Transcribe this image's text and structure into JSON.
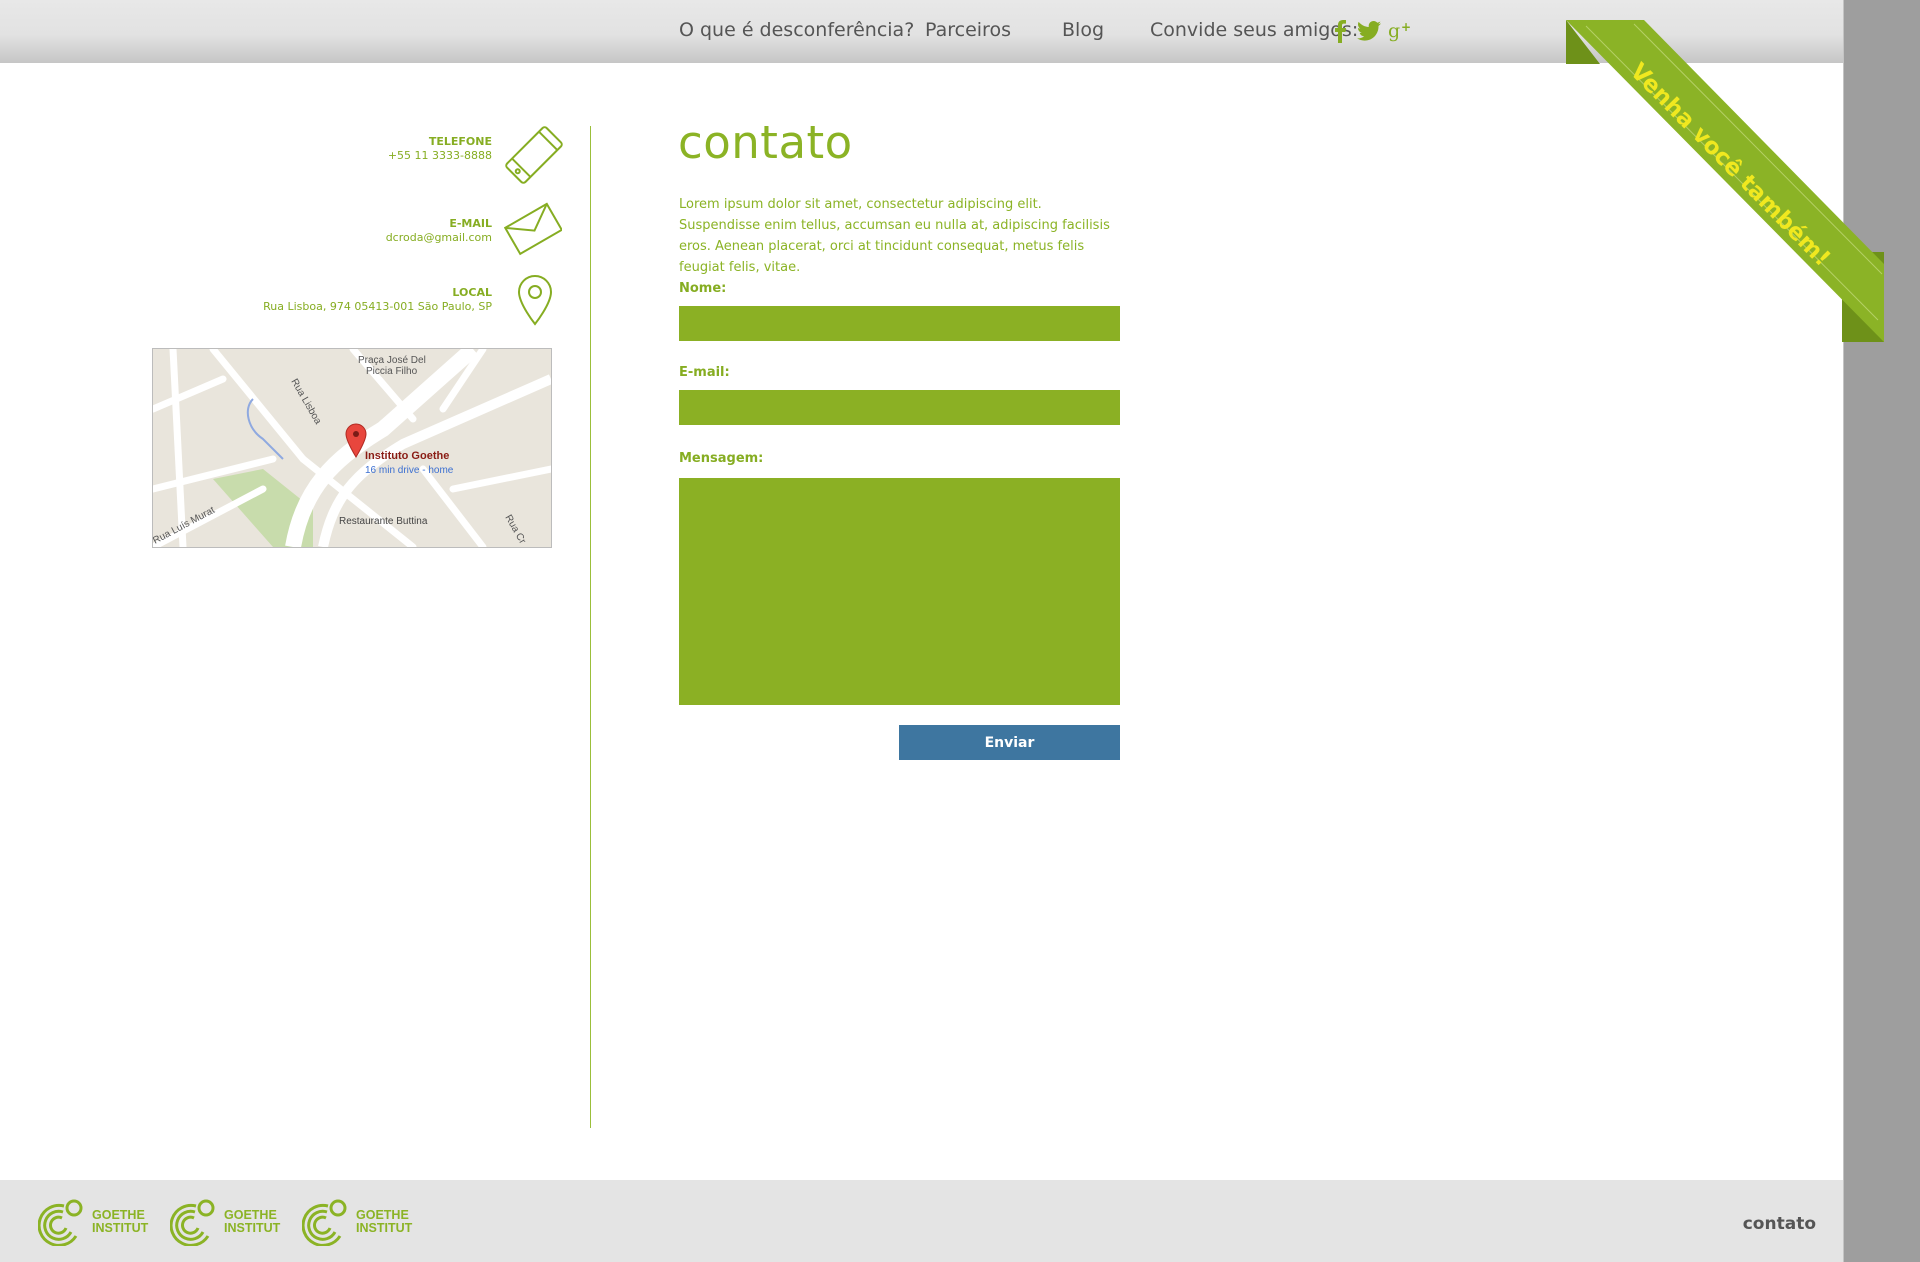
{
  "nav": {
    "items": [
      "O que é desconferência?",
      "Parceiros",
      "Blog"
    ],
    "invite_label": "Convide seus amigos:",
    "social": [
      {
        "name": "facebook-icon",
        "glyph": "f"
      },
      {
        "name": "twitter-icon",
        "glyph": "twitter"
      },
      {
        "name": "google-plus-icon",
        "glyph": "g+"
      }
    ]
  },
  "ribbon": {
    "text": "Venha você também!"
  },
  "contact_info": {
    "phone": {
      "label": "TELEFONE",
      "value": "+55 11 3333-8888"
    },
    "email": {
      "label": "E-MAIL",
      "value": "dcroda@gmail.com"
    },
    "location": {
      "label": "LOCAL",
      "value": "Rua Lisboa, 974 05413-001 São Paulo, SP"
    }
  },
  "map": {
    "place_name": "Instituto Goethe",
    "directions": "16 min drive - home",
    "street_labels": [
      "Rua Lisboa",
      "Praça José Del",
      "Piccia Filho",
      "Rua Luís Murat",
      "Restaurante Buttina",
      "Rua Cr"
    ]
  },
  "form": {
    "title": "contato",
    "intro": "Lorem ipsum dolor sit amet, consectetur adipiscing elit. Suspendisse enim tellus, accumsan eu nulla at, adipiscing facilisis eros. Aenean placerat, orci at tincidunt consequat, metus felis feugiat felis, vitae.",
    "name_label": "Nome:",
    "name_value": "",
    "email_label": "E-mail:",
    "email_value": "",
    "message_label": "Mensagem:",
    "message_value": "",
    "submit_label": "Enviar"
  },
  "footer": {
    "logos": [
      {
        "line1": "GOETHE",
        "line2": "INSTITUT"
      },
      {
        "line1": "GOETHE",
        "line2": "INSTITUT"
      },
      {
        "line1": "GOETHE",
        "line2": "INSTITUT"
      }
    ],
    "link": "contato"
  },
  "colors": {
    "brand_green": "#8bb024",
    "button_blue": "#3e76a0",
    "ribbon_text": "#f0e81f"
  }
}
